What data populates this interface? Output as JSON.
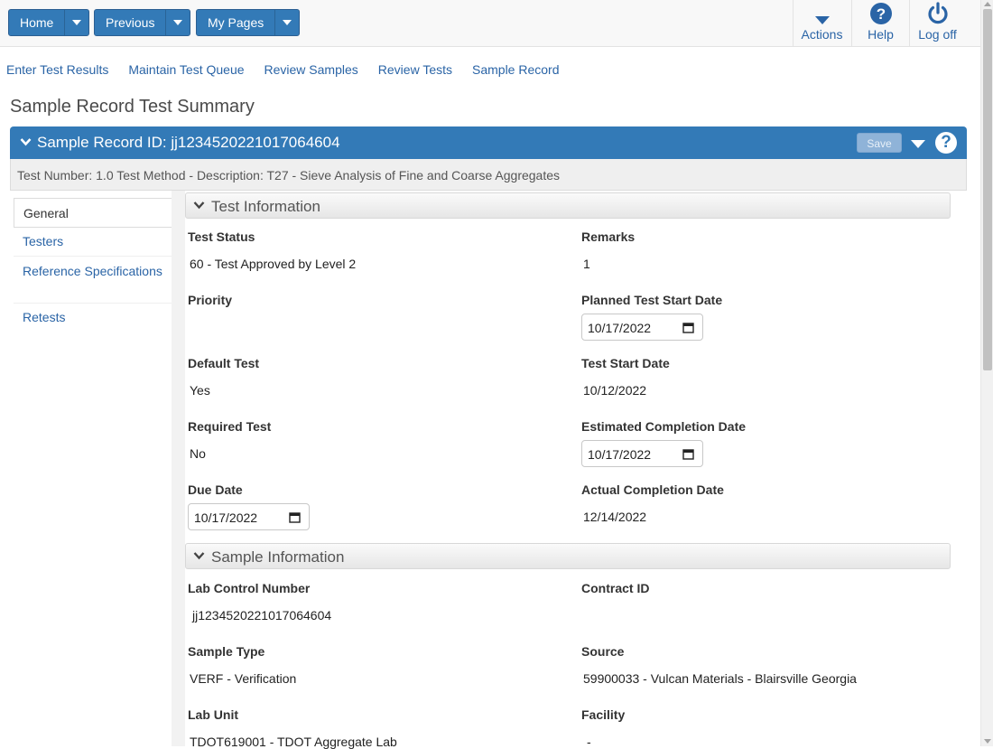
{
  "toolbar": {
    "home_label": "Home",
    "previous_label": "Previous",
    "mypages_label": "My Pages",
    "actions_label": "Actions",
    "help_label": "Help",
    "logoff_label": "Log off"
  },
  "quick_links": [
    "Enter Test Results",
    "Maintain Test Queue",
    "Review Samples",
    "Review Tests",
    "Sample Record"
  ],
  "page_title": "Sample Record Test Summary",
  "record": {
    "title": "Sample Record ID: jj1234520221017064604",
    "save_label": "Save",
    "subheader": "Test Number: 1.0 Test Method - Description: T27 - Sieve Analysis of Fine and Coarse Aggregates"
  },
  "sidebar": {
    "items": [
      "General",
      "Testers",
      "Reference Specifications",
      "Retests"
    ]
  },
  "test_info": {
    "section_title": "Test Information",
    "test_status_label": "Test Status",
    "test_status": "60 - Test Approved by Level 2",
    "remarks_label": "Remarks",
    "remarks": "1",
    "priority_label": "Priority",
    "planned_start_label": "Planned Test Start Date",
    "planned_start": "10/17/2022",
    "default_test_label": "Default Test",
    "default_test": "Yes",
    "test_start_label": "Test Start Date",
    "test_start": "10/12/2022",
    "required_test_label": "Required Test",
    "required_test": "No",
    "est_completion_label": "Estimated Completion Date",
    "est_completion": "10/17/2022",
    "due_date_label": "Due Date",
    "due_date": "10/17/2022",
    "actual_completion_label": "Actual Completion Date",
    "actual_completion": "12/14/2022"
  },
  "sample_info": {
    "section_title": "Sample Information",
    "lab_control_label": "Lab Control Number",
    "lab_control": "jj1234520221017064604",
    "contract_id_label": "Contract ID",
    "sample_type_label": "Sample Type",
    "sample_type": "VERF - Verification",
    "source_label": "Source",
    "source": "59900033 - Vulcan Materials - Blairsville Georgia",
    "lab_unit_label": "Lab Unit",
    "lab_unit": "TDOT619001 - TDOT Aggregate Lab",
    "facility_label": "Facility",
    "facility": "-"
  },
  "colors": {
    "primary": "#337ab7",
    "link": "#2a64a6"
  }
}
